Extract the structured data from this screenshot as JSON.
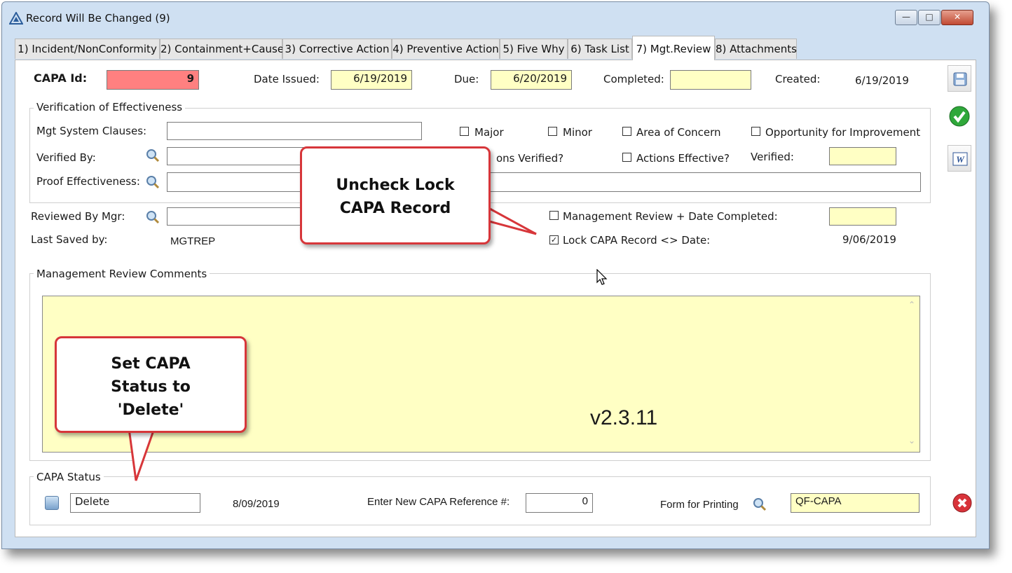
{
  "window": {
    "title": "Record Will Be Changed  (9)"
  },
  "tabs": [
    {
      "label": "1) Incident/NonConformity"
    },
    {
      "label": "2) Containment+Cause"
    },
    {
      "label": "3) Corrective Action"
    },
    {
      "label": "4) Preventive Action"
    },
    {
      "label": "5) Five Why"
    },
    {
      "label": "6) Task List"
    },
    {
      "label": "7) Mgt.Review"
    },
    {
      "label": "8) Attachments"
    }
  ],
  "header": {
    "capa_id_label": "CAPA Id:",
    "capa_id_value": "9",
    "date_issued_label": "Date Issued:",
    "date_issued_value": "6/19/2019",
    "due_label": "Due:",
    "due_value": "6/20/2019",
    "completed_label": "Completed:",
    "completed_value": "",
    "created_label": "Created:",
    "created_value": "6/19/2019"
  },
  "verification": {
    "title": "Verification of Effectiveness",
    "mgt_system_clauses_label": "Mgt System Clauses:",
    "mgt_system_clauses_value": "",
    "major_label": "Major",
    "minor_label": "Minor",
    "area_of_concern_label": "Area of Concern",
    "ofi_label": "Opportunity for Improvement",
    "verified_by_label": "Verified By:",
    "actions_verified_label": "ons Verified?",
    "actions_effective_label": "Actions Effective?",
    "verified_label": "Verified:",
    "proof_label": "Proof Effectiveness:"
  },
  "review": {
    "reviewed_by_label": "Reviewed By Mgr:",
    "last_saved_label": "Last Saved by:",
    "last_saved_value": "MGTREP",
    "mgmt_review_label": "Management Review + Date Completed:",
    "lock_label": "Lock CAPA Record <> Date:",
    "lock_checked": true,
    "lock_date": "9/06/2019"
  },
  "comments": {
    "title": "Management Review Comments",
    "version": "v2.3.11"
  },
  "status": {
    "title": "CAPA Status",
    "value": "Delete",
    "date": "8/09/2019",
    "new_ref_label": "Enter New CAPA Reference #:",
    "new_ref_value": "0",
    "form_label": "Form for Printing",
    "form_value": "QF-CAPA"
  },
  "callouts": {
    "lock_text_1": "Uncheck Lock",
    "lock_text_2": "CAPA Record",
    "status_text_1": "Set CAPA",
    "status_text_2": "Status to",
    "status_text_3": "'Delete'"
  },
  "colors": {
    "capa_id_bg": "#ff8080",
    "field_yellow": "#ffffc4",
    "callout_border": "#d7363a"
  }
}
